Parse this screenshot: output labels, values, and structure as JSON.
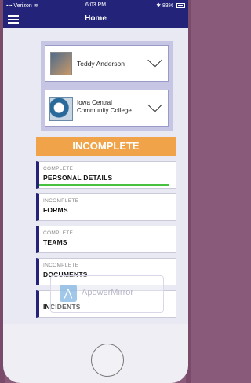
{
  "status_bar": {
    "carrier": "Verizon",
    "time": "6:03 PM",
    "battery": "83%"
  },
  "nav": {
    "title": "Home"
  },
  "athlete_selector": {
    "name": "Teddy Anderson"
  },
  "school_selector": {
    "line1": "Iowa Central",
    "line2": "Community College"
  },
  "overall_status": "INCOMPLETE",
  "steps": [
    {
      "status": "COMPLETE",
      "name": "PERSONAL DETAILS",
      "progress": 1.0
    },
    {
      "status": "INCOMPLETE",
      "name": "FORMS"
    },
    {
      "status": "COMPLETE",
      "name": "TEAMS"
    },
    {
      "status": "INCOMPLETE",
      "name": "DOCUMENTS"
    },
    {
      "status": "",
      "name": "INCIDENTS"
    }
  ],
  "watermark": "ApowerMirror",
  "colors": {
    "nav": "#23237a",
    "banner": "#f0a348",
    "progress": "#48c040"
  }
}
